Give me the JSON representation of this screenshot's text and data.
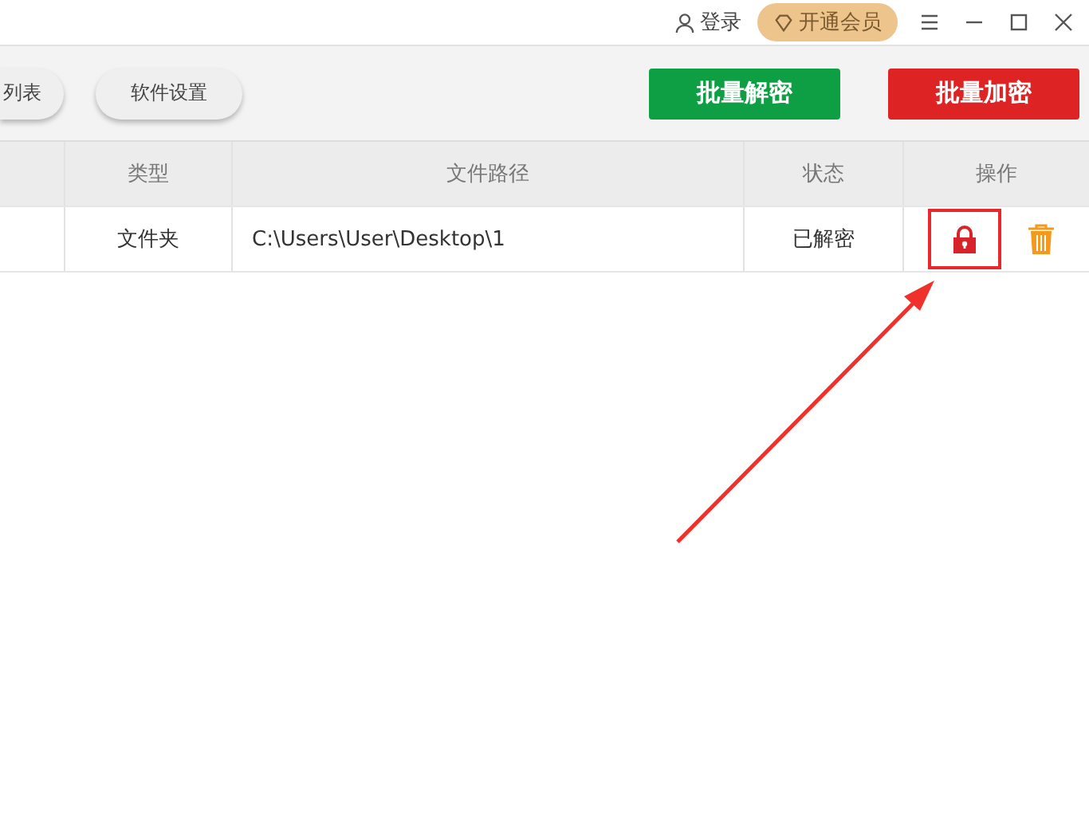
{
  "title_bar": {
    "login": "登录",
    "vip": "开通会员"
  },
  "toolbar": {
    "left_buttons": [
      "列表",
      "软件设置"
    ],
    "decrypt_button": "批量解密",
    "encrypt_button": "批量加密"
  },
  "table": {
    "columns": [
      "类型",
      "文件路径",
      "状态",
      "操作"
    ],
    "rows": [
      {
        "type": "文件夹",
        "path": "C:\\Users\\User\\Desktop\\1",
        "status": "已解密",
        "highlighted": true
      }
    ]
  }
}
